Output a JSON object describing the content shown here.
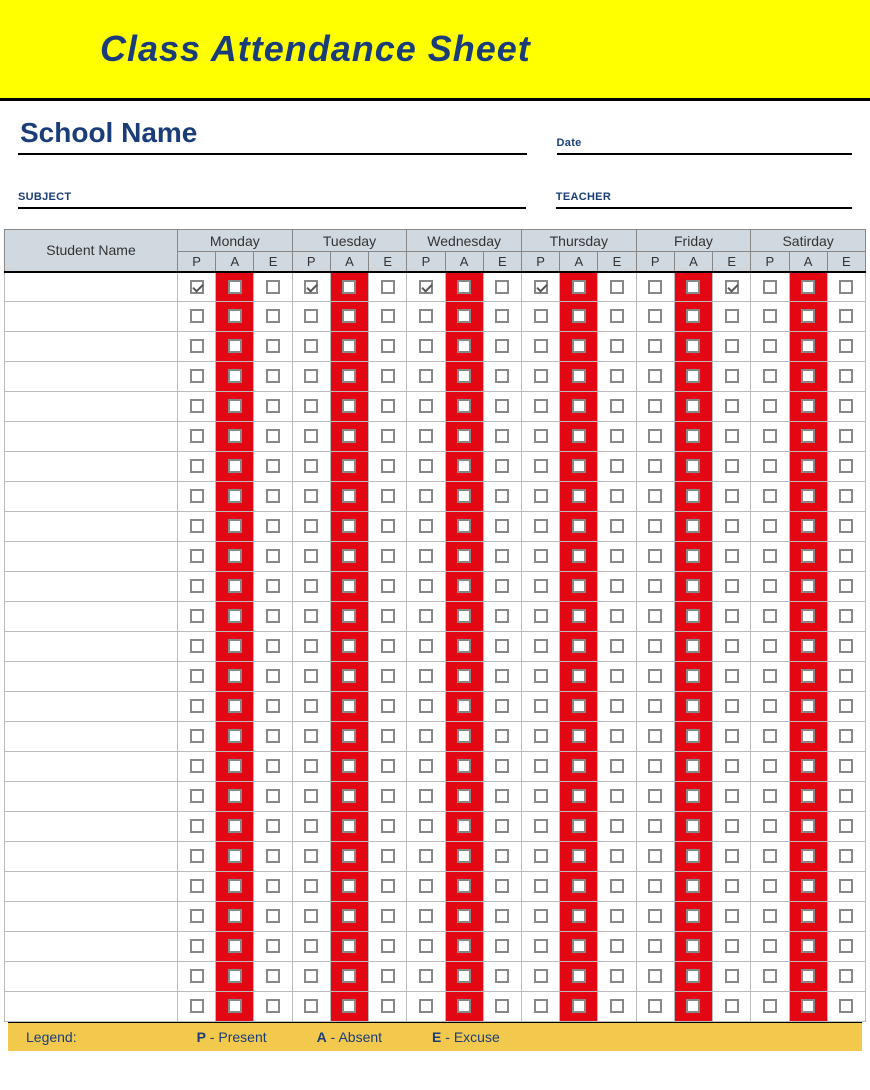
{
  "header": {
    "title": "Class Attendance Sheet"
  },
  "meta": {
    "school_name_label": "School Name",
    "date_label": "Date",
    "subject_label": "SUBJECT",
    "teacher_label": "TEACHER"
  },
  "table": {
    "student_col_label": "Student Name",
    "days": [
      "Monday",
      "Tuesday",
      "Wednesday",
      "Thursday",
      "Friday",
      "Satirday"
    ],
    "subcols": [
      "P",
      "A",
      "E"
    ],
    "rows": [
      {
        "name": "",
        "checks": [
          [
            true,
            false,
            false
          ],
          [
            true,
            false,
            false
          ],
          [
            true,
            false,
            false
          ],
          [
            true,
            false,
            false
          ],
          [
            false,
            false,
            true
          ],
          [
            false,
            false,
            false
          ]
        ]
      },
      {
        "name": "",
        "checks": [
          [
            false,
            false,
            false
          ],
          [
            false,
            false,
            false
          ],
          [
            false,
            false,
            false
          ],
          [
            false,
            false,
            false
          ],
          [
            false,
            false,
            false
          ],
          [
            false,
            false,
            false
          ]
        ]
      },
      {
        "name": "",
        "checks": [
          [
            false,
            false,
            false
          ],
          [
            false,
            false,
            false
          ],
          [
            false,
            false,
            false
          ],
          [
            false,
            false,
            false
          ],
          [
            false,
            false,
            false
          ],
          [
            false,
            false,
            false
          ]
        ]
      },
      {
        "name": "",
        "checks": [
          [
            false,
            false,
            false
          ],
          [
            false,
            false,
            false
          ],
          [
            false,
            false,
            false
          ],
          [
            false,
            false,
            false
          ],
          [
            false,
            false,
            false
          ],
          [
            false,
            false,
            false
          ]
        ]
      },
      {
        "name": "",
        "checks": [
          [
            false,
            false,
            false
          ],
          [
            false,
            false,
            false
          ],
          [
            false,
            false,
            false
          ],
          [
            false,
            false,
            false
          ],
          [
            false,
            false,
            false
          ],
          [
            false,
            false,
            false
          ]
        ]
      },
      {
        "name": "",
        "checks": [
          [
            false,
            false,
            false
          ],
          [
            false,
            false,
            false
          ],
          [
            false,
            false,
            false
          ],
          [
            false,
            false,
            false
          ],
          [
            false,
            false,
            false
          ],
          [
            false,
            false,
            false
          ]
        ]
      },
      {
        "name": "",
        "checks": [
          [
            false,
            false,
            false
          ],
          [
            false,
            false,
            false
          ],
          [
            false,
            false,
            false
          ],
          [
            false,
            false,
            false
          ],
          [
            false,
            false,
            false
          ],
          [
            false,
            false,
            false
          ]
        ]
      },
      {
        "name": "",
        "checks": [
          [
            false,
            false,
            false
          ],
          [
            false,
            false,
            false
          ],
          [
            false,
            false,
            false
          ],
          [
            false,
            false,
            false
          ],
          [
            false,
            false,
            false
          ],
          [
            false,
            false,
            false
          ]
        ]
      },
      {
        "name": "",
        "checks": [
          [
            false,
            false,
            false
          ],
          [
            false,
            false,
            false
          ],
          [
            false,
            false,
            false
          ],
          [
            false,
            false,
            false
          ],
          [
            false,
            false,
            false
          ],
          [
            false,
            false,
            false
          ]
        ]
      },
      {
        "name": "",
        "checks": [
          [
            false,
            false,
            false
          ],
          [
            false,
            false,
            false
          ],
          [
            false,
            false,
            false
          ],
          [
            false,
            false,
            false
          ],
          [
            false,
            false,
            false
          ],
          [
            false,
            false,
            false
          ]
        ]
      },
      {
        "name": "",
        "checks": [
          [
            false,
            false,
            false
          ],
          [
            false,
            false,
            false
          ],
          [
            false,
            false,
            false
          ],
          [
            false,
            false,
            false
          ],
          [
            false,
            false,
            false
          ],
          [
            false,
            false,
            false
          ]
        ]
      },
      {
        "name": "",
        "checks": [
          [
            false,
            false,
            false
          ],
          [
            false,
            false,
            false
          ],
          [
            false,
            false,
            false
          ],
          [
            false,
            false,
            false
          ],
          [
            false,
            false,
            false
          ],
          [
            false,
            false,
            false
          ]
        ]
      },
      {
        "name": "",
        "checks": [
          [
            false,
            false,
            false
          ],
          [
            false,
            false,
            false
          ],
          [
            false,
            false,
            false
          ],
          [
            false,
            false,
            false
          ],
          [
            false,
            false,
            false
          ],
          [
            false,
            false,
            false
          ]
        ]
      },
      {
        "name": "",
        "checks": [
          [
            false,
            false,
            false
          ],
          [
            false,
            false,
            false
          ],
          [
            false,
            false,
            false
          ],
          [
            false,
            false,
            false
          ],
          [
            false,
            false,
            false
          ],
          [
            false,
            false,
            false
          ]
        ]
      },
      {
        "name": "",
        "checks": [
          [
            false,
            false,
            false
          ],
          [
            false,
            false,
            false
          ],
          [
            false,
            false,
            false
          ],
          [
            false,
            false,
            false
          ],
          [
            false,
            false,
            false
          ],
          [
            false,
            false,
            false
          ]
        ]
      },
      {
        "name": "",
        "checks": [
          [
            false,
            false,
            false
          ],
          [
            false,
            false,
            false
          ],
          [
            false,
            false,
            false
          ],
          [
            false,
            false,
            false
          ],
          [
            false,
            false,
            false
          ],
          [
            false,
            false,
            false
          ]
        ]
      },
      {
        "name": "",
        "checks": [
          [
            false,
            false,
            false
          ],
          [
            false,
            false,
            false
          ],
          [
            false,
            false,
            false
          ],
          [
            false,
            false,
            false
          ],
          [
            false,
            false,
            false
          ],
          [
            false,
            false,
            false
          ]
        ]
      },
      {
        "name": "",
        "checks": [
          [
            false,
            false,
            false
          ],
          [
            false,
            false,
            false
          ],
          [
            false,
            false,
            false
          ],
          [
            false,
            false,
            false
          ],
          [
            false,
            false,
            false
          ],
          [
            false,
            false,
            false
          ]
        ]
      },
      {
        "name": "",
        "checks": [
          [
            false,
            false,
            false
          ],
          [
            false,
            false,
            false
          ],
          [
            false,
            false,
            false
          ],
          [
            false,
            false,
            false
          ],
          [
            false,
            false,
            false
          ],
          [
            false,
            false,
            false
          ]
        ]
      },
      {
        "name": "",
        "checks": [
          [
            false,
            false,
            false
          ],
          [
            false,
            false,
            false
          ],
          [
            false,
            false,
            false
          ],
          [
            false,
            false,
            false
          ],
          [
            false,
            false,
            false
          ],
          [
            false,
            false,
            false
          ]
        ]
      },
      {
        "name": "",
        "checks": [
          [
            false,
            false,
            false
          ],
          [
            false,
            false,
            false
          ],
          [
            false,
            false,
            false
          ],
          [
            false,
            false,
            false
          ],
          [
            false,
            false,
            false
          ],
          [
            false,
            false,
            false
          ]
        ]
      },
      {
        "name": "",
        "checks": [
          [
            false,
            false,
            false
          ],
          [
            false,
            false,
            false
          ],
          [
            false,
            false,
            false
          ],
          [
            false,
            false,
            false
          ],
          [
            false,
            false,
            false
          ],
          [
            false,
            false,
            false
          ]
        ]
      },
      {
        "name": "",
        "checks": [
          [
            false,
            false,
            false
          ],
          [
            false,
            false,
            false
          ],
          [
            false,
            false,
            false
          ],
          [
            false,
            false,
            false
          ],
          [
            false,
            false,
            false
          ],
          [
            false,
            false,
            false
          ]
        ]
      },
      {
        "name": "",
        "checks": [
          [
            false,
            false,
            false
          ],
          [
            false,
            false,
            false
          ],
          [
            false,
            false,
            false
          ],
          [
            false,
            false,
            false
          ],
          [
            false,
            false,
            false
          ],
          [
            false,
            false,
            false
          ]
        ]
      },
      {
        "name": "",
        "checks": [
          [
            false,
            false,
            false
          ],
          [
            false,
            false,
            false
          ],
          [
            false,
            false,
            false
          ],
          [
            false,
            false,
            false
          ],
          [
            false,
            false,
            false
          ],
          [
            false,
            false,
            false
          ]
        ]
      }
    ]
  },
  "legend": {
    "label": "Legend:",
    "items": [
      {
        "key": "P",
        "text": " - Present"
      },
      {
        "key": "A",
        "text": " - Absent"
      },
      {
        "key": "E",
        "text": " - Excuse"
      }
    ]
  }
}
